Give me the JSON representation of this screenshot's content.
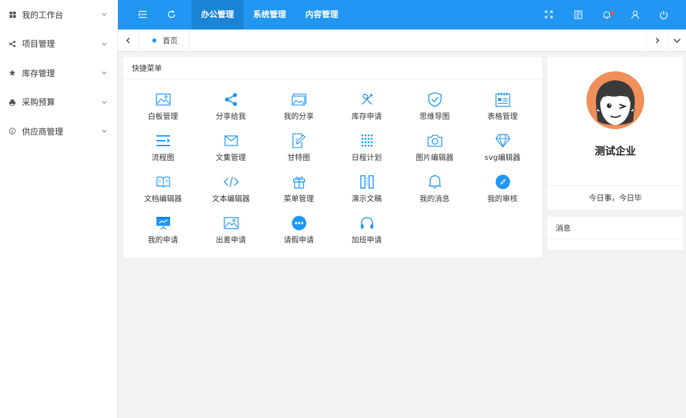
{
  "sidebar": {
    "items": [
      {
        "label": "我的工作台",
        "icon": "windows-icon"
      },
      {
        "label": "项目管理",
        "icon": "share-nodes-icon"
      },
      {
        "label": "库存管理",
        "icon": "star-icon"
      },
      {
        "label": "采购预算",
        "icon": "printer-icon"
      },
      {
        "label": "供应商管理",
        "icon": "dollar-icon"
      }
    ]
  },
  "topbar": {
    "tabs": [
      {
        "label": "办公管理",
        "active": true
      },
      {
        "label": "系统管理",
        "active": false
      },
      {
        "label": "内容管理",
        "active": false
      }
    ],
    "left_icons": [
      "menu-fold-icon",
      "refresh-icon"
    ],
    "right_icons": [
      "fullscreen-icon",
      "note-icon",
      "bell-icon",
      "user-icon",
      "power-icon"
    ],
    "accent_color": "#2196f3",
    "badge_color": "#ff5722"
  },
  "tabstrip": {
    "tabs": [
      {
        "label": "首页"
      }
    ]
  },
  "quick_menu": {
    "title": "快捷菜单",
    "items": [
      {
        "label": "白板管理",
        "icon": "image-icon"
      },
      {
        "label": "分享给我",
        "icon": "share-icon"
      },
      {
        "label": "我的分享",
        "icon": "photos-icon"
      },
      {
        "label": "库存申请",
        "icon": "tools-icon"
      },
      {
        "label": "思维导图",
        "icon": "shield-check-icon"
      },
      {
        "label": "表格管理",
        "icon": "table-icon"
      },
      {
        "label": "流程图",
        "icon": "list-indent-icon"
      },
      {
        "label": "文集管理",
        "icon": "mail-icon"
      },
      {
        "label": "甘特图",
        "icon": "edit-doc-icon"
      },
      {
        "label": "日程计划",
        "icon": "calendar-icon"
      },
      {
        "label": "图片编辑器",
        "icon": "camera-icon"
      },
      {
        "label": "svg编辑器",
        "icon": "diamond-icon"
      },
      {
        "label": "文档编辑器",
        "icon": "book-icon"
      },
      {
        "label": "文本编辑器",
        "icon": "code-icon"
      },
      {
        "label": "菜单管理",
        "icon": "gift-icon"
      },
      {
        "label": "演示文稿",
        "icon": "columns-icon"
      },
      {
        "label": "我的消息",
        "icon": "bell-icon"
      },
      {
        "label": "我的审核",
        "icon": "compass-icon"
      },
      {
        "label": "我的申请",
        "icon": "presentation-icon"
      },
      {
        "label": "出差申请",
        "icon": "image-icon"
      },
      {
        "label": "请假申请",
        "icon": "chat-dots-icon"
      },
      {
        "label": "加班申请",
        "icon": "headset-icon"
      }
    ]
  },
  "profile": {
    "company": "测试企业",
    "footer": "今日事，今日毕",
    "avatar_icon": "cartoon-avatar"
  },
  "messages": {
    "title": "消息"
  }
}
